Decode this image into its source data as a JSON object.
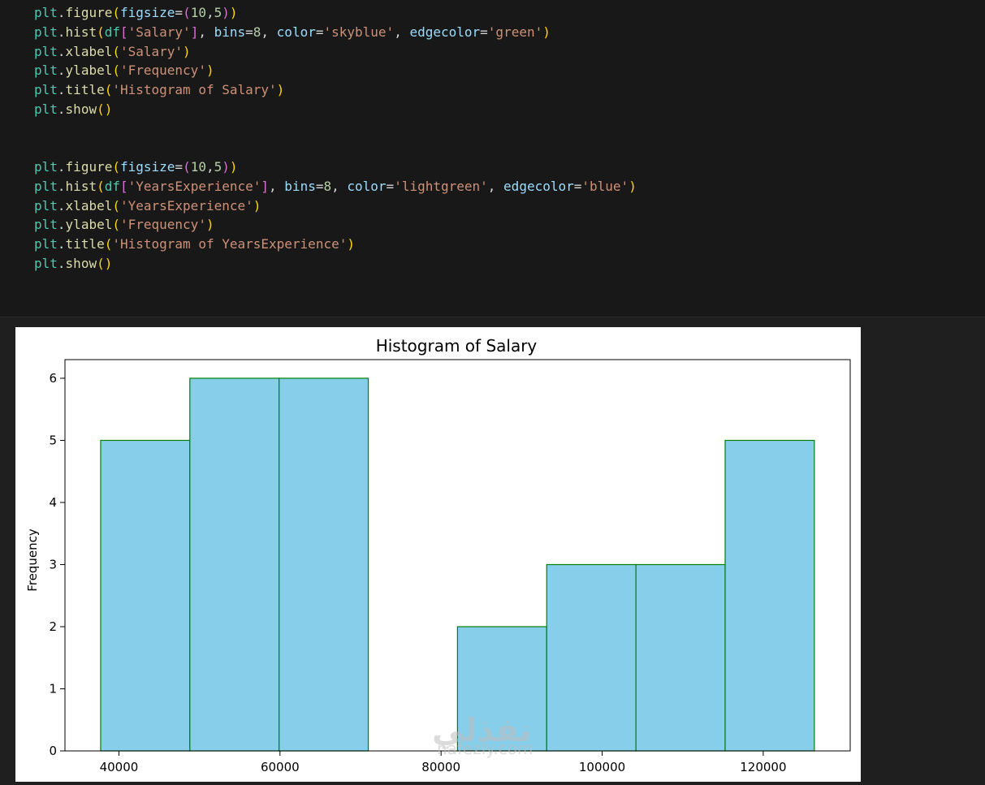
{
  "code_cell": {
    "block1": {
      "line1": {
        "obj": "plt",
        "dot": ".",
        "fn": "figure",
        "open": "(",
        "param": "figsize",
        "eq": "=",
        "topen": "(",
        "n1": "10",
        "comma": ",",
        "n2": "5",
        "tclose": ")",
        "close": ")"
      },
      "line2": {
        "obj": "plt",
        "dot": ".",
        "fn": "hist",
        "open": "(",
        "df": "df",
        "bopen": "[",
        "col": "'Salary'",
        "bclose": "]",
        "sep1": ", ",
        "p1": "bins",
        "eq1": "=",
        "v1": "8",
        "sep2": ", ",
        "p2": "color",
        "eq2": "=",
        "v2": "'skyblue'",
        "sep3": ", ",
        "p3": "edgecolor",
        "eq3": "=",
        "v3": "'green'",
        "close": ")"
      },
      "line3": {
        "obj": "plt",
        "dot": ".",
        "fn": "xlabel",
        "open": "(",
        "str": "'Salary'",
        "close": ")"
      },
      "line4": {
        "obj": "plt",
        "dot": ".",
        "fn": "ylabel",
        "open": "(",
        "str": "'Frequency'",
        "close": ")"
      },
      "line5": {
        "obj": "plt",
        "dot": ".",
        "fn": "title",
        "open": "(",
        "str": "'Histogram of Salary'",
        "close": ")"
      },
      "line6": {
        "obj": "plt",
        "dot": ".",
        "fn": "show",
        "open": "(",
        "close": ")"
      }
    },
    "block2": {
      "line1": {
        "obj": "plt",
        "dot": ".",
        "fn": "figure",
        "open": "(",
        "param": "figsize",
        "eq": "=",
        "topen": "(",
        "n1": "10",
        "comma": ",",
        "n2": "5",
        "tclose": ")",
        "close": ")"
      },
      "line2": {
        "obj": "plt",
        "dot": ".",
        "fn": "hist",
        "open": "(",
        "df": "df",
        "bopen": "[",
        "col": "'YearsExperience'",
        "bclose": "]",
        "sep1": ", ",
        "p1": "bins",
        "eq1": "=",
        "v1": "8",
        "sep2": ", ",
        "p2": "color",
        "eq2": "=",
        "v2": "'lightgreen'",
        "sep3": ", ",
        "p3": "edgecolor",
        "eq3": "=",
        "v3": "'blue'",
        "close": ")"
      },
      "line3": {
        "obj": "plt",
        "dot": ".",
        "fn": "xlabel",
        "open": "(",
        "str": "'YearsExperience'",
        "close": ")"
      },
      "line4": {
        "obj": "plt",
        "dot": ".",
        "fn": "ylabel",
        "open": "(",
        "str": "'Frequency'",
        "close": ")"
      },
      "line5": {
        "obj": "plt",
        "dot": ".",
        "fn": "title",
        "open": "(",
        "str": "'Histogram of YearsExperience'",
        "close": ")"
      },
      "line6": {
        "obj": "plt",
        "dot": ".",
        "fn": "show",
        "open": "(",
        "close": ")"
      }
    }
  },
  "chart_data": {
    "type": "bar",
    "title": "Histogram of Salary",
    "xlabel": "",
    "ylabel": "Frequency",
    "bin_edges": [
      37731,
      48808,
      59886,
      70963,
      82040,
      93118,
      104195,
      115272,
      126350
    ],
    "values": [
      5,
      6,
      6,
      0,
      2,
      3,
      3,
      5
    ],
    "xlim": [
      33300,
      130800
    ],
    "ylim": [
      0,
      6.3
    ],
    "xticks": [
      40000,
      60000,
      80000,
      100000,
      120000
    ],
    "xtick_labels": [
      "40000",
      "60000",
      "80000",
      "100000",
      "120000"
    ],
    "yticks": [
      0,
      1,
      2,
      3,
      4,
      5,
      6
    ],
    "ytick_labels": [
      "0",
      "1",
      "2",
      "3",
      "4",
      "5",
      "6"
    ],
    "bar_color": "#87ceeb",
    "edge_color": "#008000",
    "grid": false
  },
  "watermark": {
    "arabic": "نفذلي",
    "url": "nafezly.com"
  }
}
